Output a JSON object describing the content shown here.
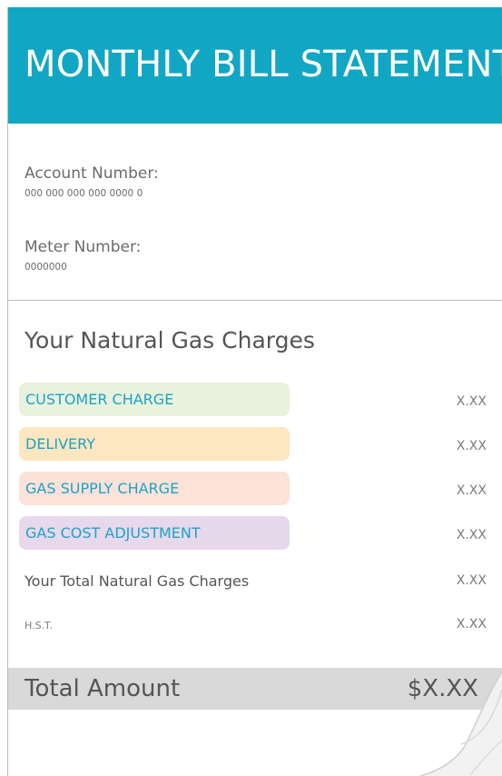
{
  "statement": {
    "title": "MONTHLY BILL STATEMENT",
    "account_label": "Account Number:",
    "account_value": "000 000 000 000 0000 0",
    "meter_label": "Meter Number:",
    "meter_value": "0000000",
    "section_title": "Your Natural Gas Charges",
    "charges": [
      {
        "label": "CUSTOMER CHARGE",
        "amount": "X.XX",
        "color": "#e8f2dc"
      },
      {
        "label": "DELIVERY",
        "amount": "X.XX",
        "color": "#fde7c0"
      },
      {
        "label": "GAS SUPPLY CHARGE",
        "amount": "X.XX",
        "color": "#fde2d8"
      },
      {
        "label": "GAS COST ADJUSTMENT",
        "amount": "X.XX",
        "color": "#e8d8ec"
      }
    ],
    "total_charges_label": "Your Total Natural Gas Charges",
    "total_charges_amount": "X.XX",
    "hst_label": "H.S.T.",
    "hst_amount": "X.XX",
    "total_label": "Total Amount",
    "total_amount": "$X.XX"
  },
  "colors": {
    "header": "#11a7c4",
    "accent_text": "#1aa3c8",
    "total_bar": "#d9d9d9"
  }
}
